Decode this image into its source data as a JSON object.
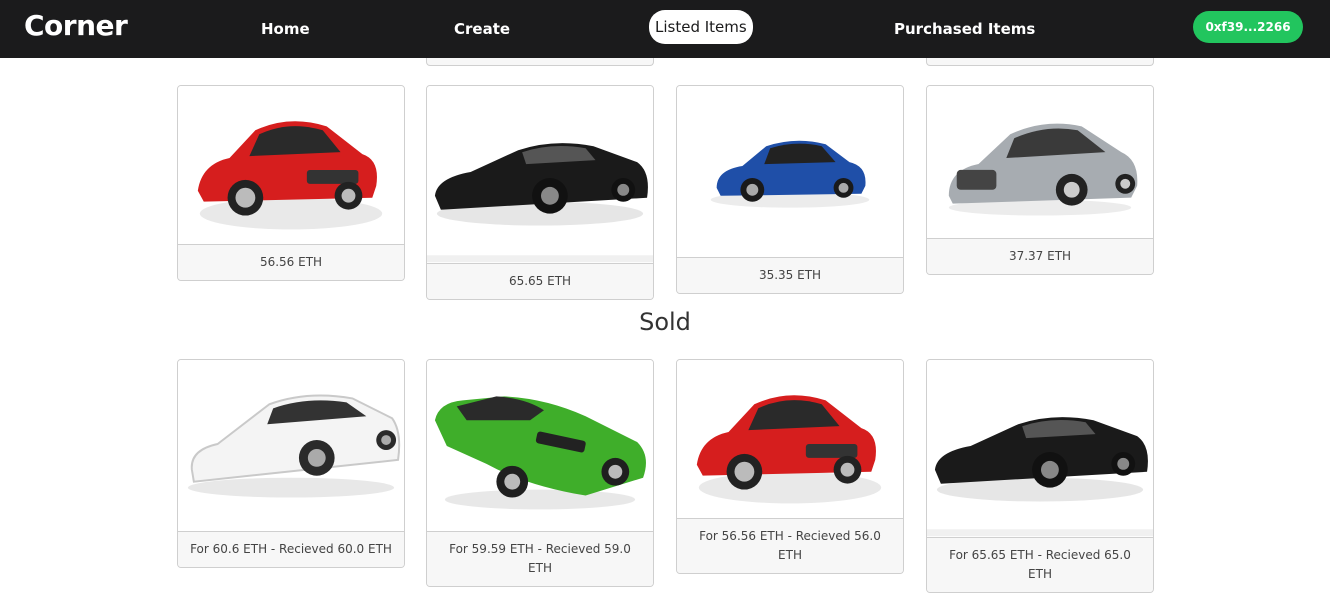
{
  "nav": {
    "brand": "Corner",
    "links": [
      "Home",
      "Create",
      "Listed Items",
      "Purchased Items"
    ],
    "active": "Listed Items",
    "wallet": "0xf39...2266"
  },
  "listed": [
    {
      "car": "red-sedan-icon",
      "price": "56.56 ETH",
      "color": "#d61e1e"
    },
    {
      "car": "black-supercar-icon",
      "price": "65.65 ETH",
      "color": "#1a1a1a"
    },
    {
      "car": "blue-sedan-icon",
      "price": "35.35 ETH",
      "color": "#1f4fa8"
    },
    {
      "car": "silver-sedan-icon",
      "price": "37.37 ETH",
      "color": "#9ea3a8"
    }
  ],
  "sold_title": "Sold",
  "sold": [
    {
      "car": "white-supercar-icon",
      "text": "For 60.6 ETH - Recieved 60.0 ETH",
      "color": "#f2f2f2"
    },
    {
      "car": "green-classic-car-icon",
      "text": "For 59.59 ETH - Recieved 59.0 ETH",
      "color": "#3fae2a"
    },
    {
      "car": "red-sedan-icon",
      "text": "For 56.56 ETH - Recieved 56.0 ETH",
      "color": "#d61e1e"
    },
    {
      "car": "black-supercar-icon",
      "text": "For 65.65 ETH - Recieved 65.0 ETH",
      "color": "#1a1a1a"
    }
  ]
}
